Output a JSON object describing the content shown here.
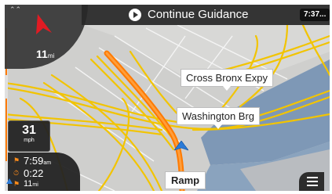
{
  "compass": {
    "distance_value": "11",
    "distance_unit": "mi",
    "chevron_icon": "chevrons-up-icon",
    "arrow_icon": "north-arrow-icon",
    "arrow_color": "#e21b23"
  },
  "guidance": {
    "label": "Continue Guidance",
    "play_icon": "play-icon"
  },
  "clock": {
    "time": "7:37..."
  },
  "map": {
    "callouts": {
      "cross": "Cross Bronx Expy",
      "washington": "Washington Brg"
    },
    "ramp": "Ramp",
    "route_color": "#ff7a00",
    "road_color": "#f2c400",
    "water_color": "#7e98b6"
  },
  "speed": {
    "value": "31",
    "unit": "mph"
  },
  "trip": {
    "eta": "7:59",
    "eta_suffix": "am",
    "remaining_time": "0:22",
    "remaining_distance": "11",
    "remaining_distance_unit": "mi",
    "icons": [
      "flag-clock-icon",
      "stopwatch-icon",
      "flag-distance-icon"
    ]
  },
  "menu": {
    "icon": "hamburger-menu-icon"
  }
}
